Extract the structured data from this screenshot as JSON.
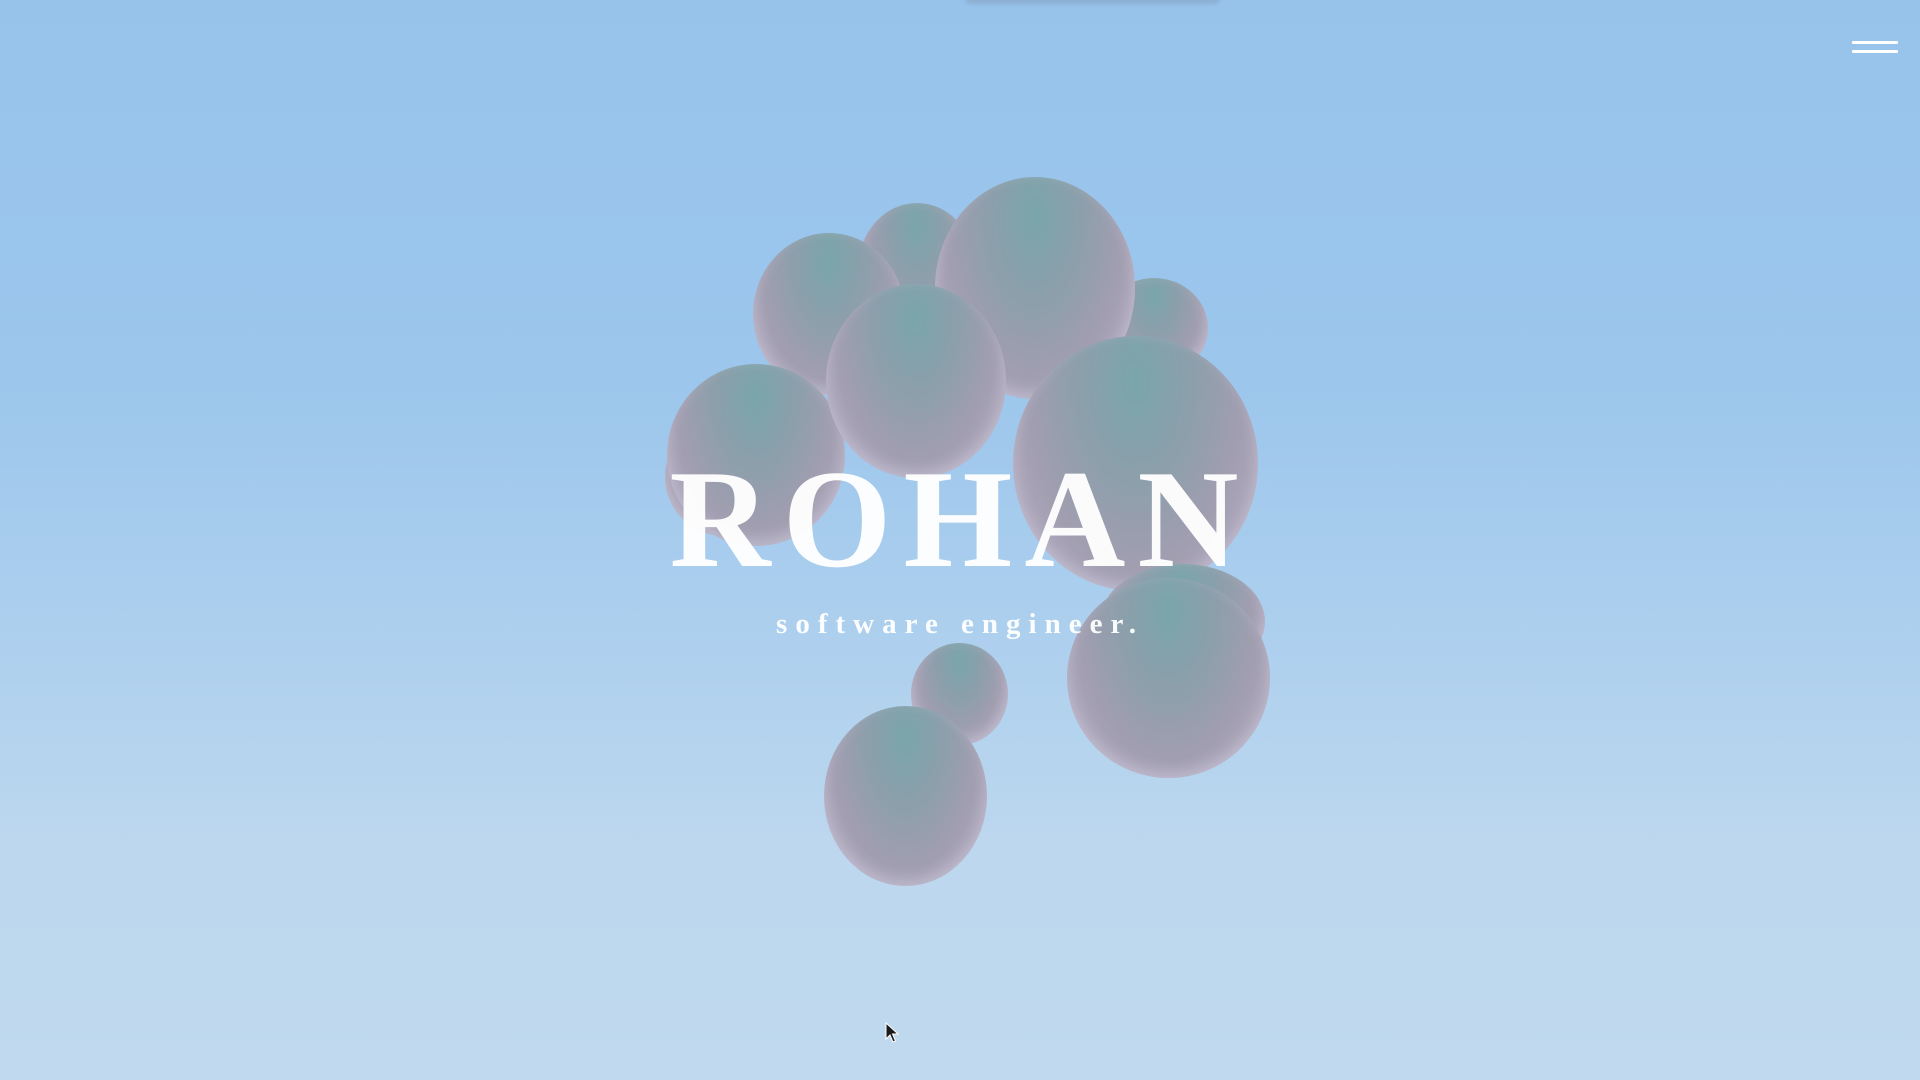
{
  "header": {
    "menu_icon": "hamburger-menu-icon"
  },
  "hero": {
    "title": "ROHAN",
    "subtitle": "software engineer."
  },
  "theme": {
    "sky_top": "#97c3eb",
    "sky_bottom": "#c0d9ee",
    "sphere_color": "#a19eb0",
    "text_color": "#ffffff"
  },
  "cursor_icon": "mouse-pointer-icon"
}
